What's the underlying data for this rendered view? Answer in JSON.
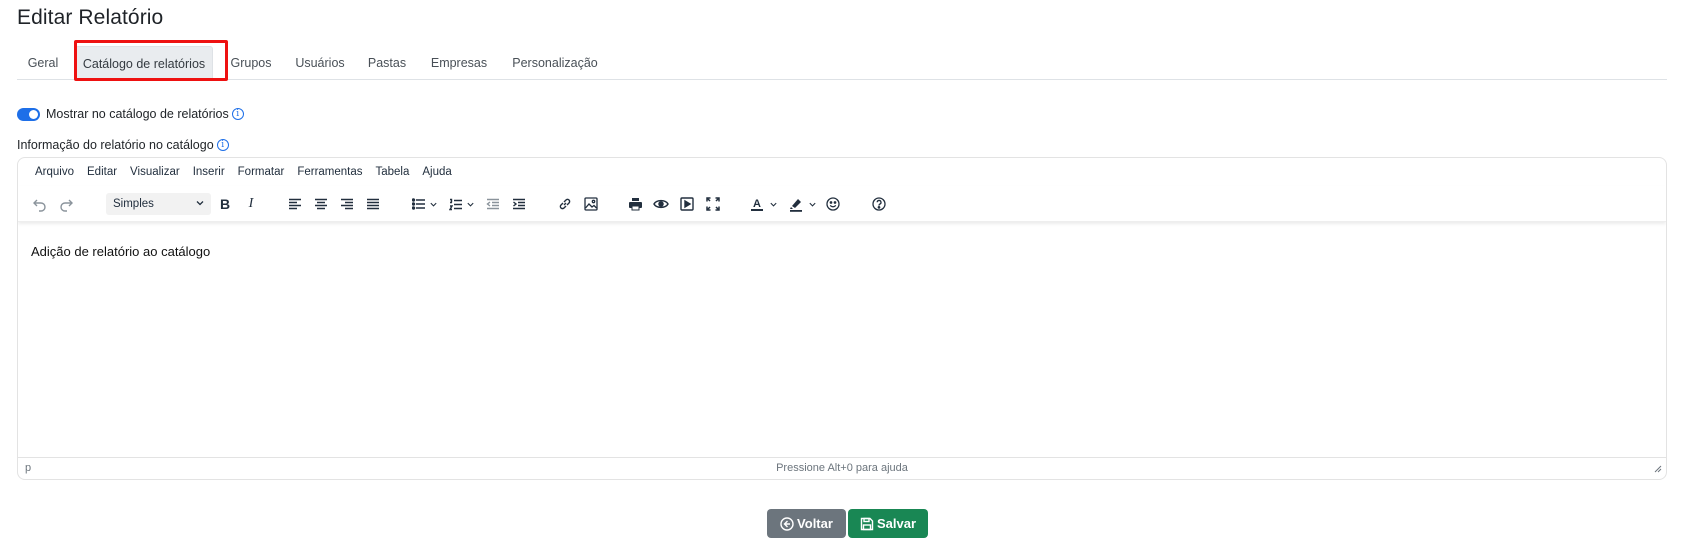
{
  "page": {
    "title": "Editar Relatório"
  },
  "tabs": [
    {
      "label": "Geral",
      "active": false
    },
    {
      "label": "Catálogo de relatórios",
      "active": true
    },
    {
      "label": "Grupos",
      "active": false
    },
    {
      "label": "Usuários",
      "active": false
    },
    {
      "label": "Pastas",
      "active": false
    },
    {
      "label": "Empresas",
      "active": false
    },
    {
      "label": "Personalização",
      "active": false
    }
  ],
  "catalog_toggle": {
    "label": "Mostrar no catálogo de relatórios",
    "checked": true
  },
  "editor_field": {
    "label": "Informação do relatório no catálogo"
  },
  "editor": {
    "menu": [
      "Arquivo",
      "Editar",
      "Visualizar",
      "Inserir",
      "Formatar",
      "Ferramentas",
      "Tabela",
      "Ajuda"
    ],
    "block_format": "Simples",
    "content": "Adição de relatório ao catálogo",
    "status_path": "p",
    "status_help": "Pressione Alt+0 para ajuda"
  },
  "actions": {
    "back_label": "Voltar",
    "save_label": "Salvar"
  },
  "colors": {
    "accent": "#1e6fe8",
    "highlight": "#ee1111",
    "back": "#6c757d",
    "save": "#198754"
  }
}
